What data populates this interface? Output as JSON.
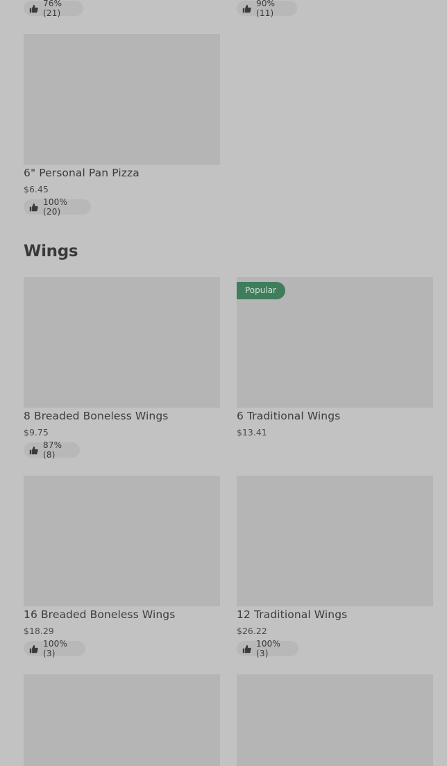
{
  "top_partial": {
    "left_rating": "76% (21)",
    "right_rating": "90% (11)"
  },
  "personal_pan": {
    "name": "6\" Personal Pan Pizza",
    "price": "$6.45",
    "rating": "100% (20)"
  },
  "wings_section": {
    "title": "Wings",
    "items": [
      {
        "name": "8 Breaded Boneless Wings",
        "price": "$9.75",
        "rating": "87% (8)",
        "badge": ""
      },
      {
        "name": "6 Traditional Wings",
        "price": "$13.41",
        "rating": "",
        "badge": "Popular"
      },
      {
        "name": "16 Breaded Boneless Wings",
        "price": "$18.29",
        "rating": "100% (3)",
        "badge": ""
      },
      {
        "name": "12 Traditional Wings",
        "price": "$26.22",
        "rating": "100% (3)",
        "badge": ""
      }
    ]
  },
  "icons": {
    "rating_icon": "thumbs-up-icon"
  },
  "colors": {
    "background": "#c2c2c2",
    "image_placeholder": "#b5b5b5",
    "rating_pill": "#b8b8b8",
    "popular_badge": "#3f7d5c"
  }
}
